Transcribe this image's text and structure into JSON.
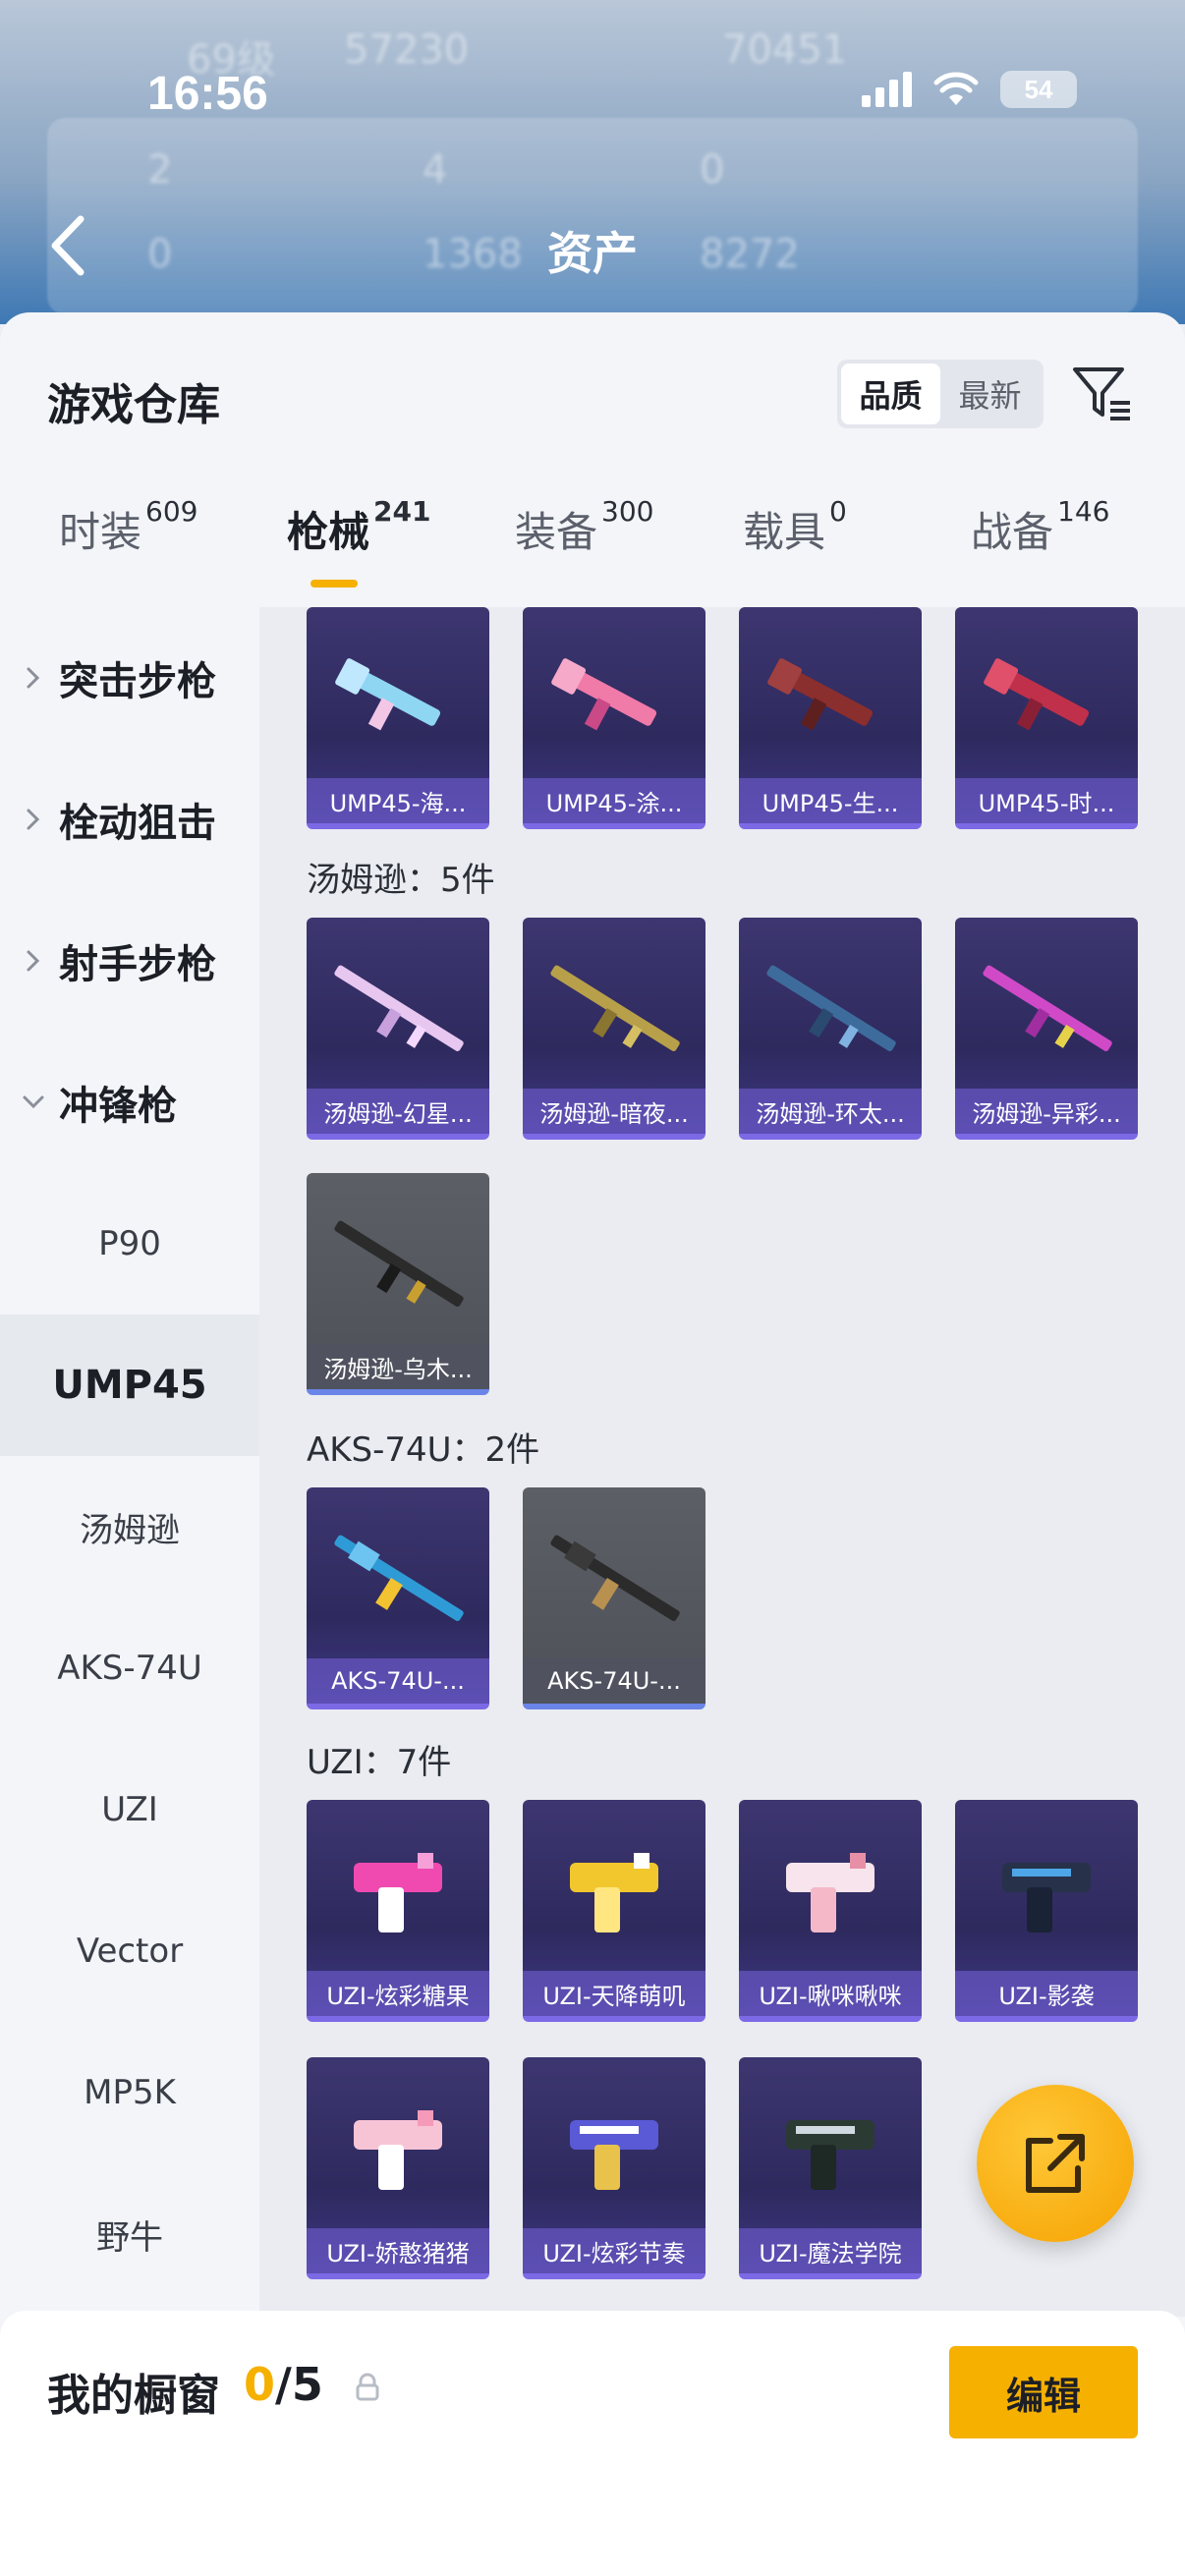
{
  "status_bar": {
    "time": "16:56",
    "battery": "54"
  },
  "header": {
    "title": "资产",
    "blurred_texts": [
      "69级",
      "57230",
      "70451",
      "2",
      "4",
      "0",
      "0",
      "1368",
      "8272"
    ]
  },
  "warehouse": {
    "title": "游戏仓库",
    "sort_options": [
      "品质",
      "最新"
    ],
    "sort_active": "品质"
  },
  "tabs": [
    {
      "label": "时装",
      "count": "609"
    },
    {
      "label": "枪械",
      "count": "241",
      "active": true
    },
    {
      "label": "装备",
      "count": "300"
    },
    {
      "label": "载具",
      "count": "0"
    },
    {
      "label": "战备",
      "count": "146"
    }
  ],
  "sidebar": {
    "categories": [
      {
        "label": "突击步枪",
        "expanded": false
      },
      {
        "label": "栓动狙击",
        "expanded": false
      },
      {
        "label": "射手步枪",
        "expanded": false
      },
      {
        "label": "冲锋枪",
        "expanded": true
      }
    ],
    "subitems": [
      "P90",
      "UMP45",
      "汤姆逊",
      "AKS-74U",
      "UZI",
      "Vector",
      "MP5K",
      "野牛"
    ],
    "selected": "UMP45"
  },
  "groups": {
    "ump45": {
      "items": [
        "UMP45-海...",
        "UMP45-涂...",
        "UMP45-生...",
        "UMP45-时..."
      ]
    },
    "thompson": {
      "title": "汤姆逊：5件",
      "items": [
        "汤姆逊-幻星...",
        "汤姆逊-暗夜...",
        "汤姆逊-环太...",
        "汤姆逊-异彩...",
        "汤姆逊-乌木..."
      ]
    },
    "aks74u": {
      "title": "AKS-74U：2件",
      "items": [
        "AKS-74U-...",
        "AKS-74U-..."
      ]
    },
    "uzi": {
      "title": "UZI：7件",
      "items": [
        "UZI-炫彩糖果",
        "UZI-天降萌叽",
        "UZI-啾咪啾咪",
        "UZI-影袭",
        "UZI-娇憨猪猪",
        "UZI-炫彩节奏",
        "UZI-魔法学院"
      ]
    }
  },
  "showcase": {
    "title": "我的橱窗",
    "current": "0",
    "total": "/5",
    "edit_label": "编辑"
  },
  "colors": {
    "accent": "#f5b000",
    "card_purple": "#3d3670",
    "card_grey": "#5c5f66",
    "card_border": "#7b69e6"
  }
}
